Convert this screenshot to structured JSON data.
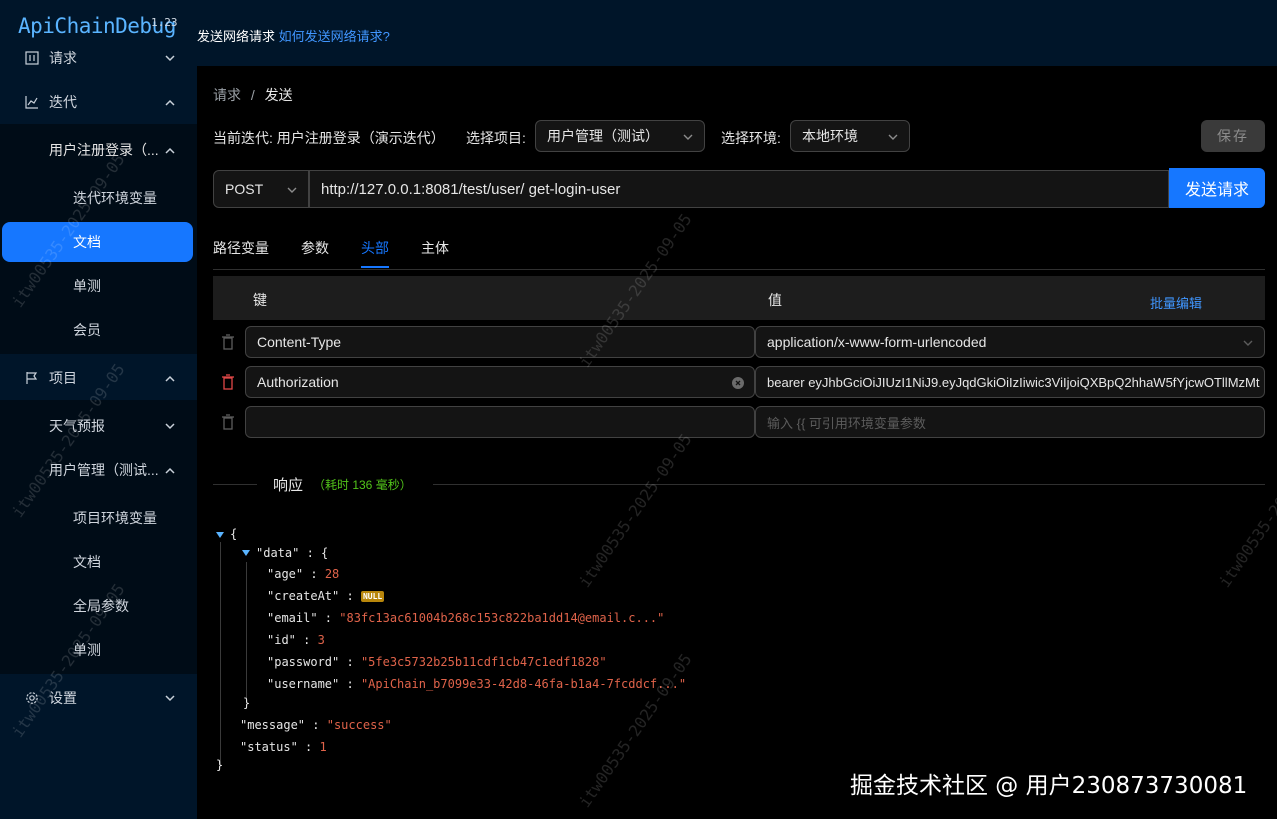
{
  "app": {
    "logo": "ApiChainDebug",
    "logo_sup": "1.23"
  },
  "topbar": {
    "text": "发送网络请求",
    "link": "如何发送网络请求?"
  },
  "sidebar": {
    "items": [
      {
        "label": "请求"
      },
      {
        "label": "迭代"
      },
      {
        "label": "用户注册登录（..."
      },
      {
        "label": "迭代环境变量"
      },
      {
        "label": "文档"
      },
      {
        "label": "单测"
      },
      {
        "label": "会员"
      },
      {
        "label": "项目"
      },
      {
        "label": "天气预报"
      },
      {
        "label": "用户管理（测试..."
      },
      {
        "label": "项目环境变量"
      },
      {
        "label": "文档"
      },
      {
        "label": "全局参数"
      },
      {
        "label": "单测"
      },
      {
        "label": "设置"
      }
    ]
  },
  "breadcrumb": {
    "root": "请求",
    "sep": "/",
    "current": "发送"
  },
  "context": {
    "iteration_label": "当前迭代: 用户注册登录（演示迭代）",
    "project_label": "选择项目:",
    "project_value": "用户管理（测试）",
    "env_label": "选择环境:",
    "env_value": "本地环境",
    "save": "保存"
  },
  "request": {
    "method": "POST",
    "url": "http://127.0.0.1:8081/test/user/ get-login-user",
    "send": "发送请求"
  },
  "tabs": [
    "路径变量",
    "参数",
    "头部",
    "主体"
  ],
  "headers_table": {
    "col_key": "键",
    "col_value": "值",
    "bulk_edit": "批量编辑",
    "rows": [
      {
        "key": "Content-Type",
        "value": "application/x-www-form-urlencoded"
      },
      {
        "key": "Authorization",
        "value": "bearer eyJhbGciOiJIUzI1NiJ9.eyJqdGkiOiIzIiwic3ViIjoiQXBpQ2hhaW5fYjcwOTllMzMt"
      },
      {
        "key": "",
        "value_placeholder": "输入 {{ 可引用环境变量参数"
      }
    ]
  },
  "response": {
    "title": "响应",
    "time": "（耗时 136 毫秒）",
    "json": {
      "open": "{",
      "data_key": "\"data\"",
      "age_key": "\"age\"",
      "age": "28",
      "createAt_key": "\"createAt\"",
      "createAt": "NULL",
      "email_key": "\"email\"",
      "email": "\"83fc13ac61004b268c153c822ba1dd14@email.c...\"",
      "id_key": "\"id\"",
      "id": "3",
      "password_key": "\"password\"",
      "password": "\"5fe3c5732b25b11cdf1cb47c1edf1828\"",
      "username_key": "\"username\"",
      "username": "\"ApiChain_b7099e33-42d8-46fa-b1a4-7fcddcf...\"",
      "message_key": "\"message\"",
      "message": "\"success\"",
      "status_key": "\"status\"",
      "status": "1",
      "close": "}"
    }
  },
  "watermark": {
    "credit": "掘金技术社区 @ 用户230873730081",
    "stamp": "itw00535-2025-09-05"
  },
  "colors": {
    "accent": "#1677ff",
    "sidebar_bg": "#001529",
    "json_value": "#e0634a"
  }
}
